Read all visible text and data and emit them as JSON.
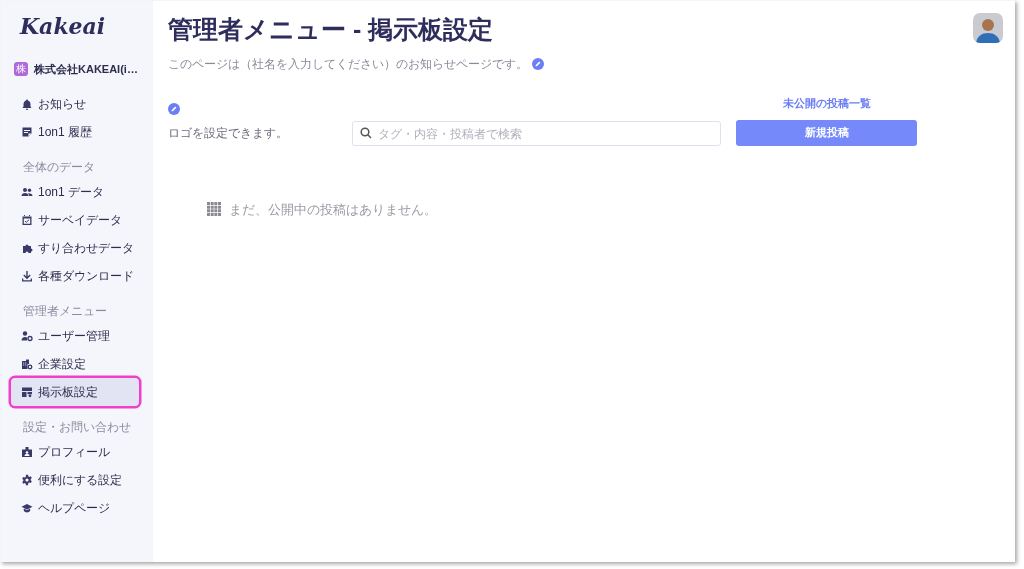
{
  "sidebar": {
    "logo": "Kakeai",
    "company": {
      "badge": "株",
      "name": "株式会社KAKEAI(i…"
    },
    "sections": [
      {
        "items": [
          {
            "label": "お知らせ",
            "selected": false
          },
          {
            "label": "1on1 履歴",
            "selected": false
          }
        ]
      },
      {
        "heading": "全体のデータ",
        "items": [
          {
            "label": "1on1 データ",
            "selected": false
          },
          {
            "label": "サーベイデータ",
            "selected": false
          },
          {
            "label": "すり合わせデータ",
            "selected": false
          },
          {
            "label": "各種ダウンロード",
            "selected": false
          }
        ]
      },
      {
        "heading": "管理者メニュー",
        "items": [
          {
            "label": "ユーザー管理",
            "selected": false
          },
          {
            "label": "企業設定",
            "selected": false
          },
          {
            "label": "掲示板設定",
            "selected": true
          }
        ]
      },
      {
        "heading": "設定・お問い合わせ",
        "items": [
          {
            "label": "プロフィール",
            "selected": false
          },
          {
            "label": "便利にする設定",
            "selected": false
          },
          {
            "label": "ヘルプページ",
            "selected": false
          }
        ]
      }
    ]
  },
  "main": {
    "title": "管理者メニュー - 掲示板設定",
    "subtitle": "このページは（社名を入力してください）のお知らせページです。",
    "logo_hint": "ロゴを設定できます。",
    "search": {
      "placeholder": "タグ・内容・投稿者で検索"
    },
    "drafts_link": "未公開の投稿一覧",
    "new_post_button": "新規投稿",
    "empty_message": "まだ、公開中の投稿はありません。"
  }
}
